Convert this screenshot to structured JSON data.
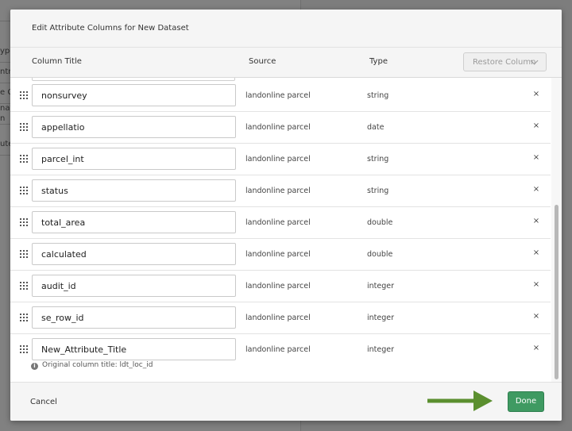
{
  "background": {
    "rows": [
      "ype",
      "ntry",
      "e C",
      "nat",
      "n",
      "ute"
    ]
  },
  "modal": {
    "title": "Edit Attribute Columns for New Dataset",
    "columns": {
      "title": "Column Title",
      "source": "Source",
      "type": "Type"
    },
    "restore_label": "Restore Column",
    "rows": [
      {
        "title": "nonsurvey",
        "source": "landonline parcel",
        "type": "string"
      },
      {
        "title": "appellatio",
        "source": "landonline parcel",
        "type": "date"
      },
      {
        "title": "parcel_int",
        "source": "landonline parcel",
        "type": "string"
      },
      {
        "title": "status",
        "source": "landonline parcel",
        "type": "string"
      },
      {
        "title": "total_area",
        "source": "landonline parcel",
        "type": "double"
      },
      {
        "title": "calculated",
        "source": "landonline parcel",
        "type": "double"
      },
      {
        "title": "audit_id",
        "source": "landonline parcel",
        "type": "integer"
      },
      {
        "title": "se_row_id",
        "source": "landonline parcel",
        "type": "integer"
      },
      {
        "title": "New_Attribute_Title",
        "source": "landonline parcel",
        "type": "integer",
        "note": "Original column title: ldt_loc_id"
      }
    ],
    "remove_glyph": "×",
    "info_glyph": "i",
    "cancel_label": "Cancel",
    "done_label": "Done",
    "colors": {
      "done": "#3f9a62",
      "arrow": "#5b8f2f"
    }
  }
}
